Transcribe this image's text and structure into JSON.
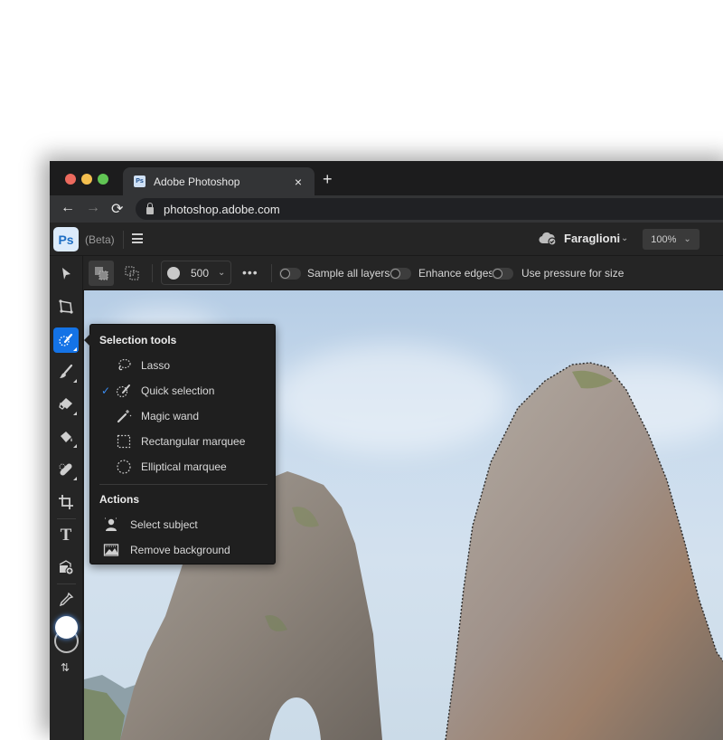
{
  "browser": {
    "tab_title": "Adobe Photoshop",
    "tab_favicon": "Ps",
    "tab_close": "×",
    "new_tab": "+",
    "url": "photoshop.adobe.com",
    "nav": {
      "back": "←",
      "forward": "→",
      "reload": "⟳"
    }
  },
  "app": {
    "logo": "Ps",
    "beta_label": "(Beta)",
    "document_name": "Faraglioni",
    "document_chevron": "⌄",
    "zoom_level": "100%",
    "zoom_chevron": "⌄"
  },
  "options_bar": {
    "brush_size": "500",
    "brush_chevron": "⌄",
    "more": "•••",
    "toggles": [
      {
        "label": "Sample all layers",
        "on": false
      },
      {
        "label": "Enhance edges",
        "on": false
      },
      {
        "label": "Use pressure for size",
        "on": false
      }
    ]
  },
  "toolbar": {
    "tools": [
      {
        "name": "move",
        "icon": "arrow-cursor-icon"
      },
      {
        "name": "transform",
        "icon": "transform-icon"
      },
      {
        "name": "selection",
        "icon": "quick-selection-icon",
        "active": true
      },
      {
        "name": "brush",
        "icon": "brush-icon"
      },
      {
        "name": "eraser",
        "icon": "eraser-icon"
      },
      {
        "name": "paint-bucket",
        "icon": "paint-bucket-icon"
      },
      {
        "name": "healing",
        "icon": "bandage-icon"
      },
      {
        "name": "crop",
        "icon": "crop-icon"
      },
      {
        "name": "type",
        "icon": "type-icon"
      },
      {
        "name": "add-image",
        "icon": "add-image-icon"
      },
      {
        "name": "eyedropper",
        "icon": "eyedropper-icon"
      }
    ],
    "type_glyph": "T",
    "swap_glyph": "⇅",
    "foreground_color": "#ffffff",
    "background_color": "transparent"
  },
  "popover": {
    "section1_title": "Selection tools",
    "items": [
      {
        "label": "Lasso",
        "checked": false
      },
      {
        "label": "Quick selection",
        "checked": true
      },
      {
        "label": "Magic wand",
        "checked": false
      },
      {
        "label": "Rectangular marquee",
        "checked": false
      },
      {
        "label": "Elliptical marquee",
        "checked": false
      }
    ],
    "check_glyph": "✓",
    "section2_title": "Actions",
    "actions": [
      {
        "label": "Select subject"
      },
      {
        "label": "Remove background"
      }
    ]
  },
  "colors": {
    "accent": "#1473e6",
    "chrome_dark": "#1c1c1d",
    "panel": "#252525"
  }
}
